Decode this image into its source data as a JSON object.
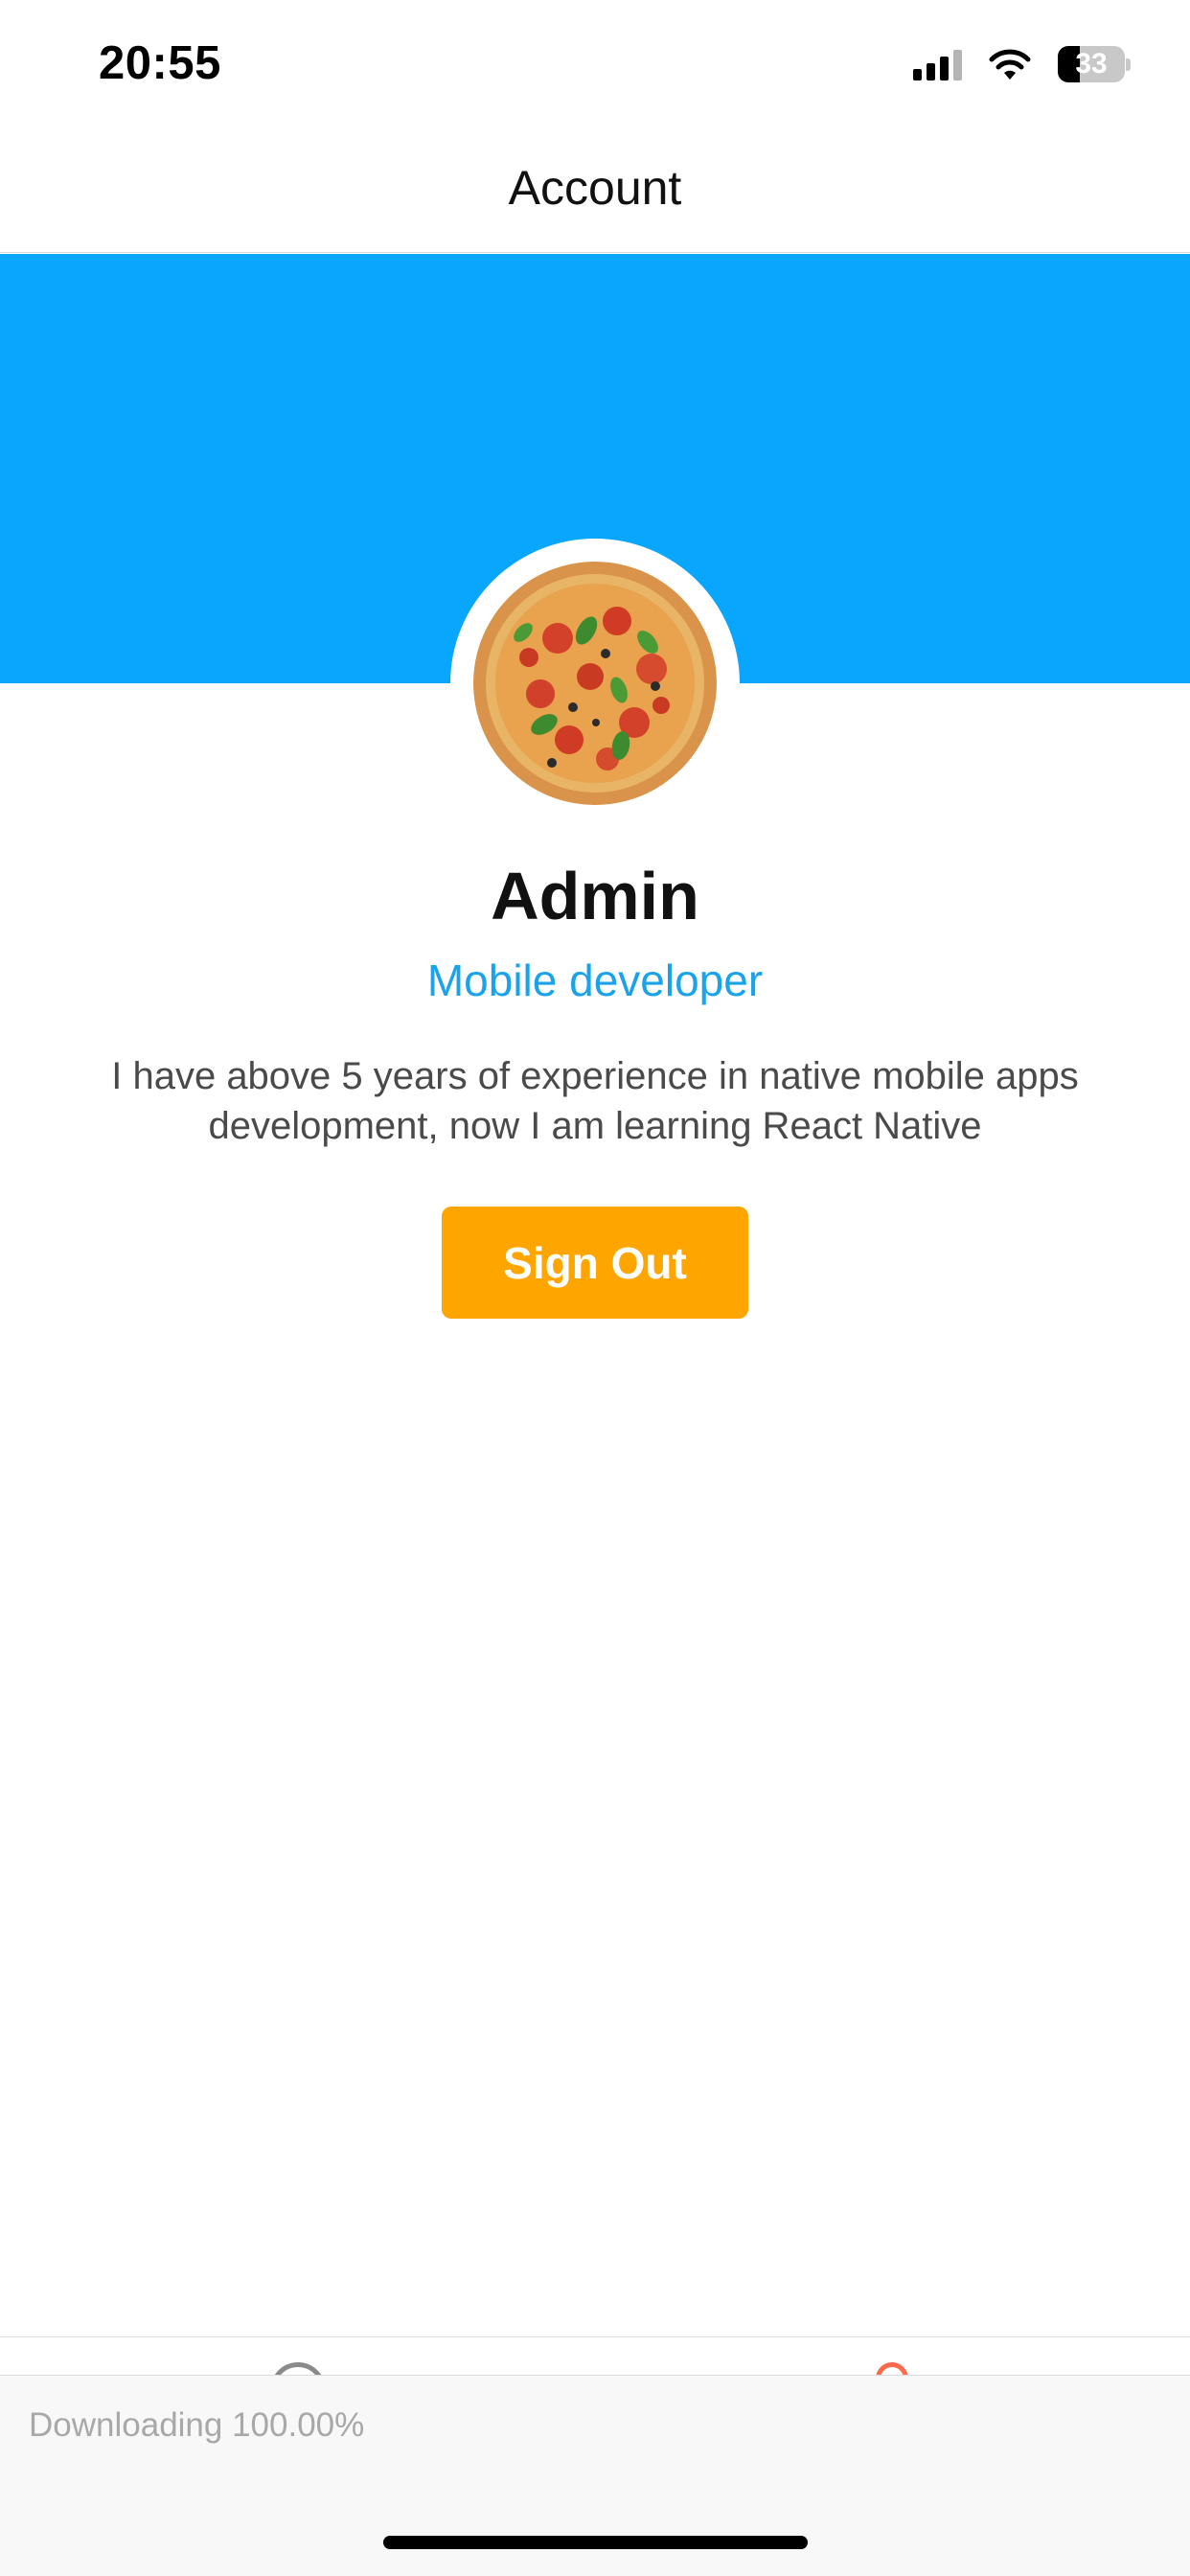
{
  "status_bar": {
    "time": "20:55",
    "battery_level": "33",
    "battery_percent": 33,
    "icons": [
      "signal-icon",
      "wifi-icon",
      "battery-icon"
    ]
  },
  "nav": {
    "title": "Account"
  },
  "profile": {
    "name": "Admin",
    "role": "Mobile developer",
    "bio": "I have above 5 years of experience in native mobile apps development, now I am learning React Native",
    "avatar": "pizza-avatar-image"
  },
  "actions": {
    "sign_out_label": "Sign Out"
  },
  "tab_bar": {
    "icons": [
      "home-icon",
      "account-icon"
    ],
    "active": "account"
  },
  "download": {
    "status_text": "Downloading 100.00%",
    "progress_percent": 100
  },
  "colors": {
    "header_blue": "#08a6fd",
    "role_blue": "#1aa3ea",
    "button_orange": "#ffa500",
    "active_tab": "#ff6a4d"
  }
}
